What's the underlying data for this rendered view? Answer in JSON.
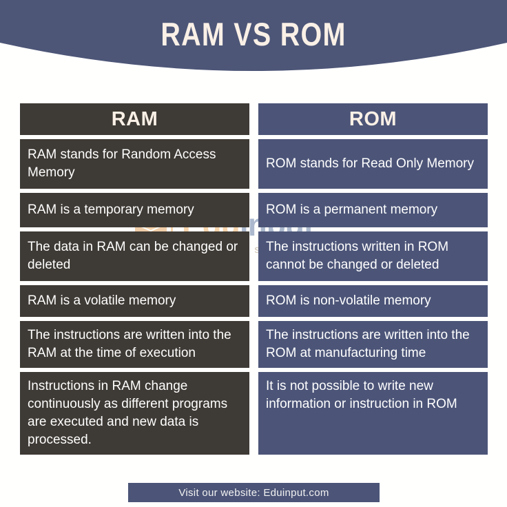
{
  "header": {
    "title": "RAM VS ROM",
    "banner_color": "#4d5677",
    "title_color": "#faf0e6"
  },
  "watermark": {
    "brand_edu": "Edu",
    "brand_input": "input",
    "tagline": "Education on sharing",
    "cap_icon": "graduation-cap-icon",
    "accent_color": "#e8942f",
    "secondary_color": "#2f4f86"
  },
  "table": {
    "columns": [
      {
        "label": "RAM",
        "color": "#3e3a35"
      },
      {
        "label": "ROM",
        "color": "#4c5578"
      }
    ],
    "rows": [
      {
        "ram": "RAM stands for Random Access Memory",
        "rom": "ROM stands for Read Only Memory"
      },
      {
        "ram": "RAM is a temporary memory",
        "rom": "ROM is a permanent memory"
      },
      {
        "ram": "The data in RAM can be changed or deleted",
        "rom": "The instructions written in ROM cannot be changed or deleted"
      },
      {
        "ram": "RAM is a volatile memory",
        "rom": "ROM is non-volatile memory"
      },
      {
        "ram": "The instructions are written into the RAM at the time of execution",
        "rom": "The instructions are written into the ROM at manufacturing time"
      },
      {
        "ram": "Instructions in RAM change continuously as different programs are executed and new data is processed.",
        "rom": "It is not possible to write new information or instruction in ROM"
      }
    ]
  },
  "footer": {
    "text": "Visit our website: Eduinput.com",
    "background": "#4c5578"
  }
}
